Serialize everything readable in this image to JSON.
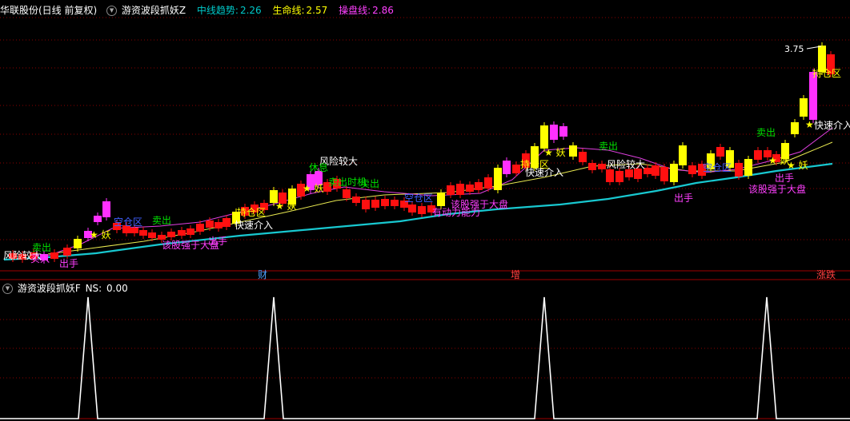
{
  "main_panel": {
    "stock_title": "华联股份(日线 前复权)",
    "indicator_name": "游资波段抓妖Z",
    "indicator_values": [
      {
        "label": "中线趋势:",
        "value": "2.26",
        "color": "#00c8c8"
      },
      {
        "label": "生命线:",
        "value": "2.57",
        "color": "#ffff00"
      },
      {
        "label": "操盘线:",
        "value": "2.86",
        "color": "#ff40ff"
      }
    ],
    "price_marker": "3.75",
    "date_markers": [
      {
        "text": "财",
        "color": "#4ea0ff"
      },
      {
        "text": "增",
        "color": "#ff4040"
      },
      {
        "text": "涨跌",
        "color": "#ff4040"
      }
    ]
  },
  "sub_panel": {
    "indicator_name": "游资波段抓妖F",
    "ns_label": "NS:",
    "ns_value": "0.00"
  },
  "annotations": [
    {
      "text": "风险较大",
      "color": "#ffffff"
    },
    {
      "text": "卖出",
      "color": "#00e000"
    },
    {
      "text": "买入",
      "color": "#ff40ff"
    },
    {
      "text": "出手",
      "color": "#ff40ff"
    },
    {
      "text": "空仓区",
      "color": "#4060ff"
    },
    {
      "text": "卖出",
      "color": "#00e000"
    },
    {
      "text": "★ 妖",
      "color": "#ffff00"
    },
    {
      "text": "该股强于大盘",
      "color": "#ff40ff"
    },
    {
      "text": "出手",
      "color": "#ff40ff"
    },
    {
      "text": "快速介入",
      "color": "#ffffff"
    },
    {
      "text": "持仓区",
      "color": "#ffff00"
    },
    {
      "text": "★ 妖",
      "color": "#ffff00"
    },
    {
      "text": "风险较大",
      "color": "#ffffff"
    },
    {
      "text": "休息",
      "color": "#00e000"
    },
    {
      "text": "★ 妖",
      "color": "#ffff00"
    },
    {
      "text": "卖出时机",
      "color": "#00e000"
    },
    {
      "text": "卖出",
      "color": "#00e000"
    },
    {
      "text": "空仓区",
      "color": "#4060ff"
    },
    {
      "text": "该股强于大盘",
      "color": "#ff40ff"
    },
    {
      "text": "有动力能力",
      "color": "#ff40ff"
    },
    {
      "text": "持仓区",
      "color": "#ffff00"
    },
    {
      "text": "★ 妖",
      "color": "#ffff00"
    },
    {
      "text": "快速介入",
      "color": "#ffffff"
    },
    {
      "text": "卖出",
      "color": "#00e000"
    },
    {
      "text": "风险较大",
      "color": "#ffffff"
    },
    {
      "text": "出手",
      "color": "#ff40ff"
    },
    {
      "text": "空仓区",
      "color": "#4060ff"
    },
    {
      "text": "卖出",
      "color": "#00e000"
    },
    {
      "text": "★ 妖",
      "color": "#ffff00"
    },
    {
      "text": "★ 妖",
      "color": "#ffff00"
    },
    {
      "text": "出手",
      "color": "#ff40ff"
    },
    {
      "text": "该股强于大盘",
      "color": "#ff40ff"
    },
    {
      "text": "★",
      "color": "#ffff00"
    },
    {
      "text": "快速介入",
      "color": "#ffffff"
    },
    {
      "text": "持仓区",
      "color": "#ffff00"
    }
  ],
  "colors": {
    "background": "#000000",
    "grid": "#8a0000",
    "candle_up": "#ffff00",
    "candle_down": "#ff1010",
    "candle_special": "#ff30ff",
    "mid_trend": "#18c8d0",
    "life_line": "#e8e850",
    "operate_line": "#e040e0"
  }
}
